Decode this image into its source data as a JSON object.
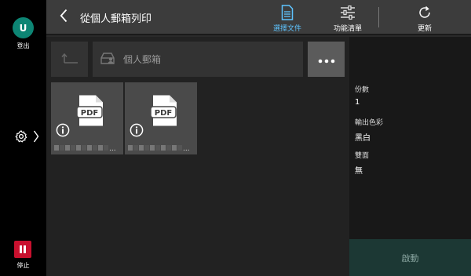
{
  "left_rail": {
    "avatar_letter": "U",
    "logout_label": "登出",
    "stop_label": "停止"
  },
  "topbar": {
    "title": "從個人郵箱列印",
    "select_label": "選擇文件",
    "functions_label": "功能清單",
    "refresh_label": "更新"
  },
  "toolbar": {
    "mailbox_label": "個人郵箱"
  },
  "files": [
    {
      "type_label": "PDF"
    },
    {
      "type_label": "PDF"
    }
  ],
  "properties": [
    {
      "key": "份數",
      "value": "1"
    },
    {
      "key": "輸出色彩",
      "value": "黑白"
    },
    {
      "key": "雙面",
      "value": "無"
    }
  ],
  "start_label": "啟動",
  "colors": {
    "accent": "#5ec4ff",
    "avatar": "#0d8574",
    "stop": "#c8102e",
    "start_bg": "#1c3834"
  }
}
